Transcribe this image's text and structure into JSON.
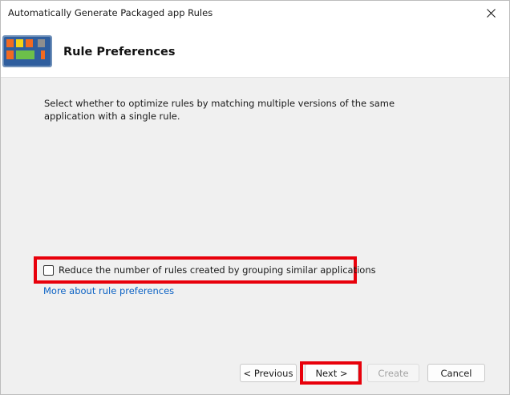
{
  "window": {
    "title": "Automatically Generate Packaged app Rules"
  },
  "header": {
    "title": "Rule Preferences",
    "icon": "applocker-app-tiles-icon"
  },
  "body": {
    "description": "Select whether to optimize rules by matching multiple versions of the same application with a single rule.",
    "group_checkbox": {
      "label": "Reduce the number of rules created by grouping similar applications",
      "checked": false
    },
    "more_link": "More about rule preferences"
  },
  "buttons": {
    "previous": "< Previous",
    "next": "Next >",
    "create": "Create",
    "cancel": "Cancel"
  },
  "colors": {
    "highlight": "#e8000b",
    "link": "#0b62c4",
    "background": "#f0f0f0"
  }
}
